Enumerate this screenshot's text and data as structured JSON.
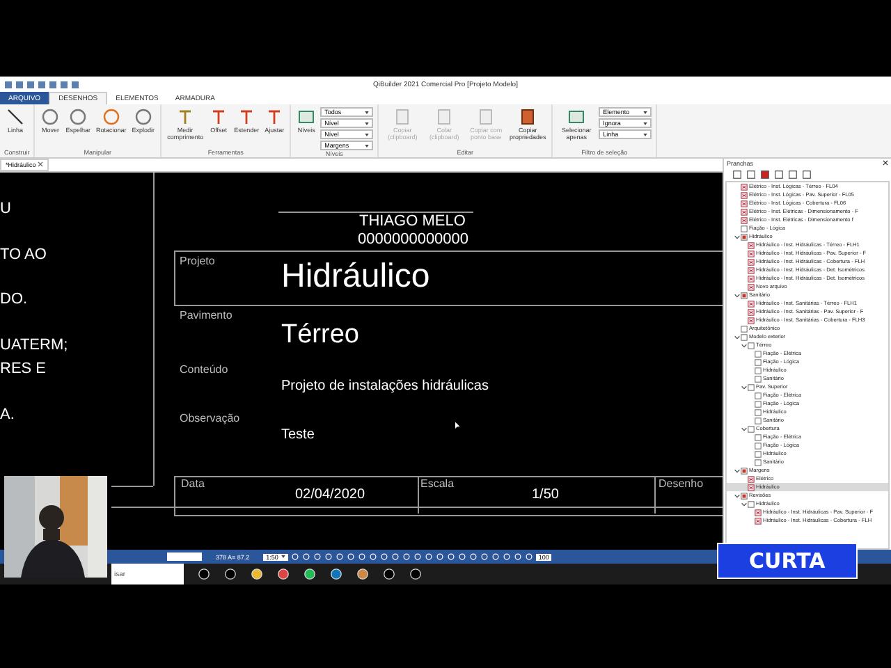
{
  "window": {
    "title": "QiBuilder 2021 Comercial Pro [Projeto Modelo]"
  },
  "ribbon_tabs": [
    {
      "label": "ARQUIVO",
      "kind": "file",
      "selected": false
    },
    {
      "label": "DESENHOS",
      "kind": "tab",
      "selected": true
    },
    {
      "label": "ELEMENTOS",
      "kind": "tab",
      "selected": false
    },
    {
      "label": "ARMADURA",
      "kind": "tab",
      "selected": false
    }
  ],
  "ribbon_groups": [
    {
      "label": "Construir",
      "buttons": [
        {
          "label": "Linha",
          "disabled": false
        }
      ]
    },
    {
      "label": "Manipular",
      "buttons": [
        {
          "label": "Mover",
          "disabled": false
        },
        {
          "label": "Espelhar",
          "disabled": false
        },
        {
          "label": "Rotacionar",
          "disabled": false
        },
        {
          "label": "Explodir",
          "disabled": false
        }
      ]
    },
    {
      "label": "Ferramentas",
      "buttons": [
        {
          "label": "Medir comprimento",
          "disabled": false
        },
        {
          "label": "Offset",
          "disabled": false
        },
        {
          "label": "Estender",
          "disabled": false
        },
        {
          "label": "Ajustar",
          "disabled": false
        }
      ]
    },
    {
      "label": "Níveis",
      "buttons": [
        {
          "label": "Níveis",
          "disabled": false
        }
      ],
      "dropdowns": [
        {
          "value": "Todos"
        },
        {
          "value": "Nível"
        },
        {
          "value": "Nível"
        },
        {
          "value": "Margens"
        }
      ]
    },
    {
      "label": "Editar",
      "buttons": [
        {
          "label": "Copiar (clipboard)",
          "disabled": true
        },
        {
          "label": "Colar (clipboard)",
          "disabled": true
        },
        {
          "label": "Copiar com ponto base",
          "disabled": true
        },
        {
          "label": "Copiar propriedades",
          "disabled": false
        }
      ]
    },
    {
      "label": "Filtro de seleção",
      "buttons": [
        {
          "label": "Selecionar apenas",
          "disabled": false
        }
      ],
      "dropdowns": [
        {
          "value": "Elemento"
        },
        {
          "value": "Ignora"
        },
        {
          "value": "Linha"
        }
      ]
    }
  ],
  "document_tab": {
    "label": "*Hidráulico"
  },
  "canvas": {
    "notes": [
      "U",
      "TO AO",
      "DO.",
      "UATERM;",
      "RES E",
      "A."
    ],
    "title_block": {
      "author": "THIAGO MELO",
      "code": "0000000000000",
      "fields": [
        {
          "label": "Projeto",
          "value": "Hidráulico",
          "kind": "large"
        },
        {
          "label": "Pavimento",
          "value": "Térreo",
          "kind": "medium"
        },
        {
          "label": "Conteúdo",
          "value": "Projeto de instalações hidráulicas",
          "kind": "normal"
        },
        {
          "label": "Observação",
          "value": "Teste",
          "kind": "normal"
        }
      ],
      "footer": [
        {
          "label": "Data",
          "value": "02/04/2020"
        },
        {
          "label": "Escala",
          "value": "1/50"
        },
        {
          "label": "Desenho"
        }
      ]
    }
  },
  "sheets_panel": {
    "title": "Pranchas",
    "tree": [
      {
        "label": "Elétrico - Inst. Lógicas - Térreo - FL04",
        "kind": "sheet",
        "selected": false
      },
      {
        "label": "Elétrico - Inst. Lógicas - Pav. Superior - FL05",
        "kind": "sheet",
        "selected": false
      },
      {
        "label": "Elétrico - Inst. Lógicas - Cobertura - FL06",
        "kind": "sheet",
        "selected": false
      },
      {
        "label": "Elétrico - Inst. Elétricas - Dimensionamento - F",
        "kind": "sheet",
        "selected": false
      },
      {
        "label": "Elétrico - Inst. Elétricas - Dimensionamento f",
        "kind": "sheet",
        "selected": false
      },
      {
        "label": "Fiação - Lógica",
        "kind": "folder",
        "selected": false
      },
      {
        "label": "Hidráulico",
        "kind": "group",
        "expanded": true,
        "selected": false,
        "children": [
          {
            "label": "Hidráulico - Inst. Hidráulicas - Térreo - FLH1",
            "kind": "sheet",
            "selected": false
          },
          {
            "label": "Hidráulico - Inst. Hidráulicas - Pav. Superior - F",
            "kind": "sheet",
            "selected": false
          },
          {
            "label": "Hidráulico - Inst. Hidráulicas - Cobertura - FLH",
            "kind": "sheet",
            "selected": false
          },
          {
            "label": "Hidráulico - Inst. Hidráulicas - Det. Isométricos",
            "kind": "sheet",
            "selected": false
          },
          {
            "label": "Hidráulico - Inst. Hidráulicas - Det. Isométricos",
            "kind": "sheet",
            "selected": false
          },
          {
            "label": "Novo arquivo",
            "kind": "sheet",
            "selected": false
          }
        ]
      },
      {
        "label": "Sanitário",
        "kind": "group",
        "expanded": true,
        "selected": false,
        "children": [
          {
            "label": "Hidráulico - Inst. Sanitárias - Térreo - FLH1",
            "kind": "sheet",
            "selected": false
          },
          {
            "label": "Hidráulico - Inst. Sanitárias - Pav. Superior - F",
            "kind": "sheet",
            "selected": false
          },
          {
            "label": "Hidráulico - Inst. Sanitárias - Cobertura - FLH3",
            "kind": "sheet",
            "selected": false
          }
        ]
      },
      {
        "label": "Arquitetônico",
        "kind": "folder",
        "selected": false
      },
      {
        "label": "Modelo exterior",
        "kind": "folder",
        "expanded": true,
        "selected": false,
        "children": [
          {
            "label": "Térreo",
            "kind": "folder",
            "expanded": true,
            "selected": false,
            "children": [
              {
                "label": "Fiação - Elétrica",
                "kind": "folder",
                "selected": false
              },
              {
                "label": "Fiação - Lógica",
                "kind": "folder",
                "selected": false
              },
              {
                "label": "Hidráulico",
                "kind": "folder",
                "selected": false
              },
              {
                "label": "Sanitário",
                "kind": "folder",
                "selected": false
              }
            ]
          },
          {
            "label": "Pav. Superior",
            "kind": "folder",
            "expanded": true,
            "selected": false,
            "children": [
              {
                "label": "Fiação - Elétrica",
                "kind": "folder",
                "selected": false
              },
              {
                "label": "Fiação - Lógica",
                "kind": "folder",
                "selected": false
              },
              {
                "label": "Hidráulico",
                "kind": "folder",
                "selected": false
              },
              {
                "label": "Sanitário",
                "kind": "folder",
                "selected": false
              }
            ]
          },
          {
            "label": "Cobertura",
            "kind": "folder",
            "expanded": true,
            "selected": false,
            "children": [
              {
                "label": "Fiação - Elétrica",
                "kind": "folder",
                "selected": false
              },
              {
                "label": "Fiação - Lógica",
                "kind": "folder",
                "selected": false
              },
              {
                "label": "Hidráulico",
                "kind": "folder",
                "selected": false
              },
              {
                "label": "Sanitário",
                "kind": "folder",
                "selected": false
              }
            ]
          }
        ]
      },
      {
        "label": "Margens",
        "kind": "group",
        "expanded": true,
        "selected": false,
        "children": [
          {
            "label": "Elétrico",
            "kind": "sheet",
            "selected": false
          },
          {
            "label": "Hidráulico",
            "kind": "sheet",
            "selected": true
          }
        ]
      },
      {
        "label": "Revisões",
        "kind": "group",
        "expanded": true,
        "selected": false,
        "children": [
          {
            "label": "Hidráulico",
            "kind": "folder",
            "expanded": true,
            "selected": false,
            "children": [
              {
                "label": "Hidráulico - Inst. Hidráulicas - Pav. Superior - F",
                "kind": "sheet",
                "selected": false
              },
              {
                "label": "Hidráulico - Inst. Hidráulicas - Cobertura - FLH",
                "kind": "sheet",
                "selected": false
              }
            ]
          }
        ]
      }
    ]
  },
  "status_bar": {
    "coords": "378 A= 87.2",
    "scale": "1:50",
    "zoom": "100"
  },
  "taskbar": {
    "search": "isar"
  },
  "badge": {
    "label": "CURTA"
  }
}
